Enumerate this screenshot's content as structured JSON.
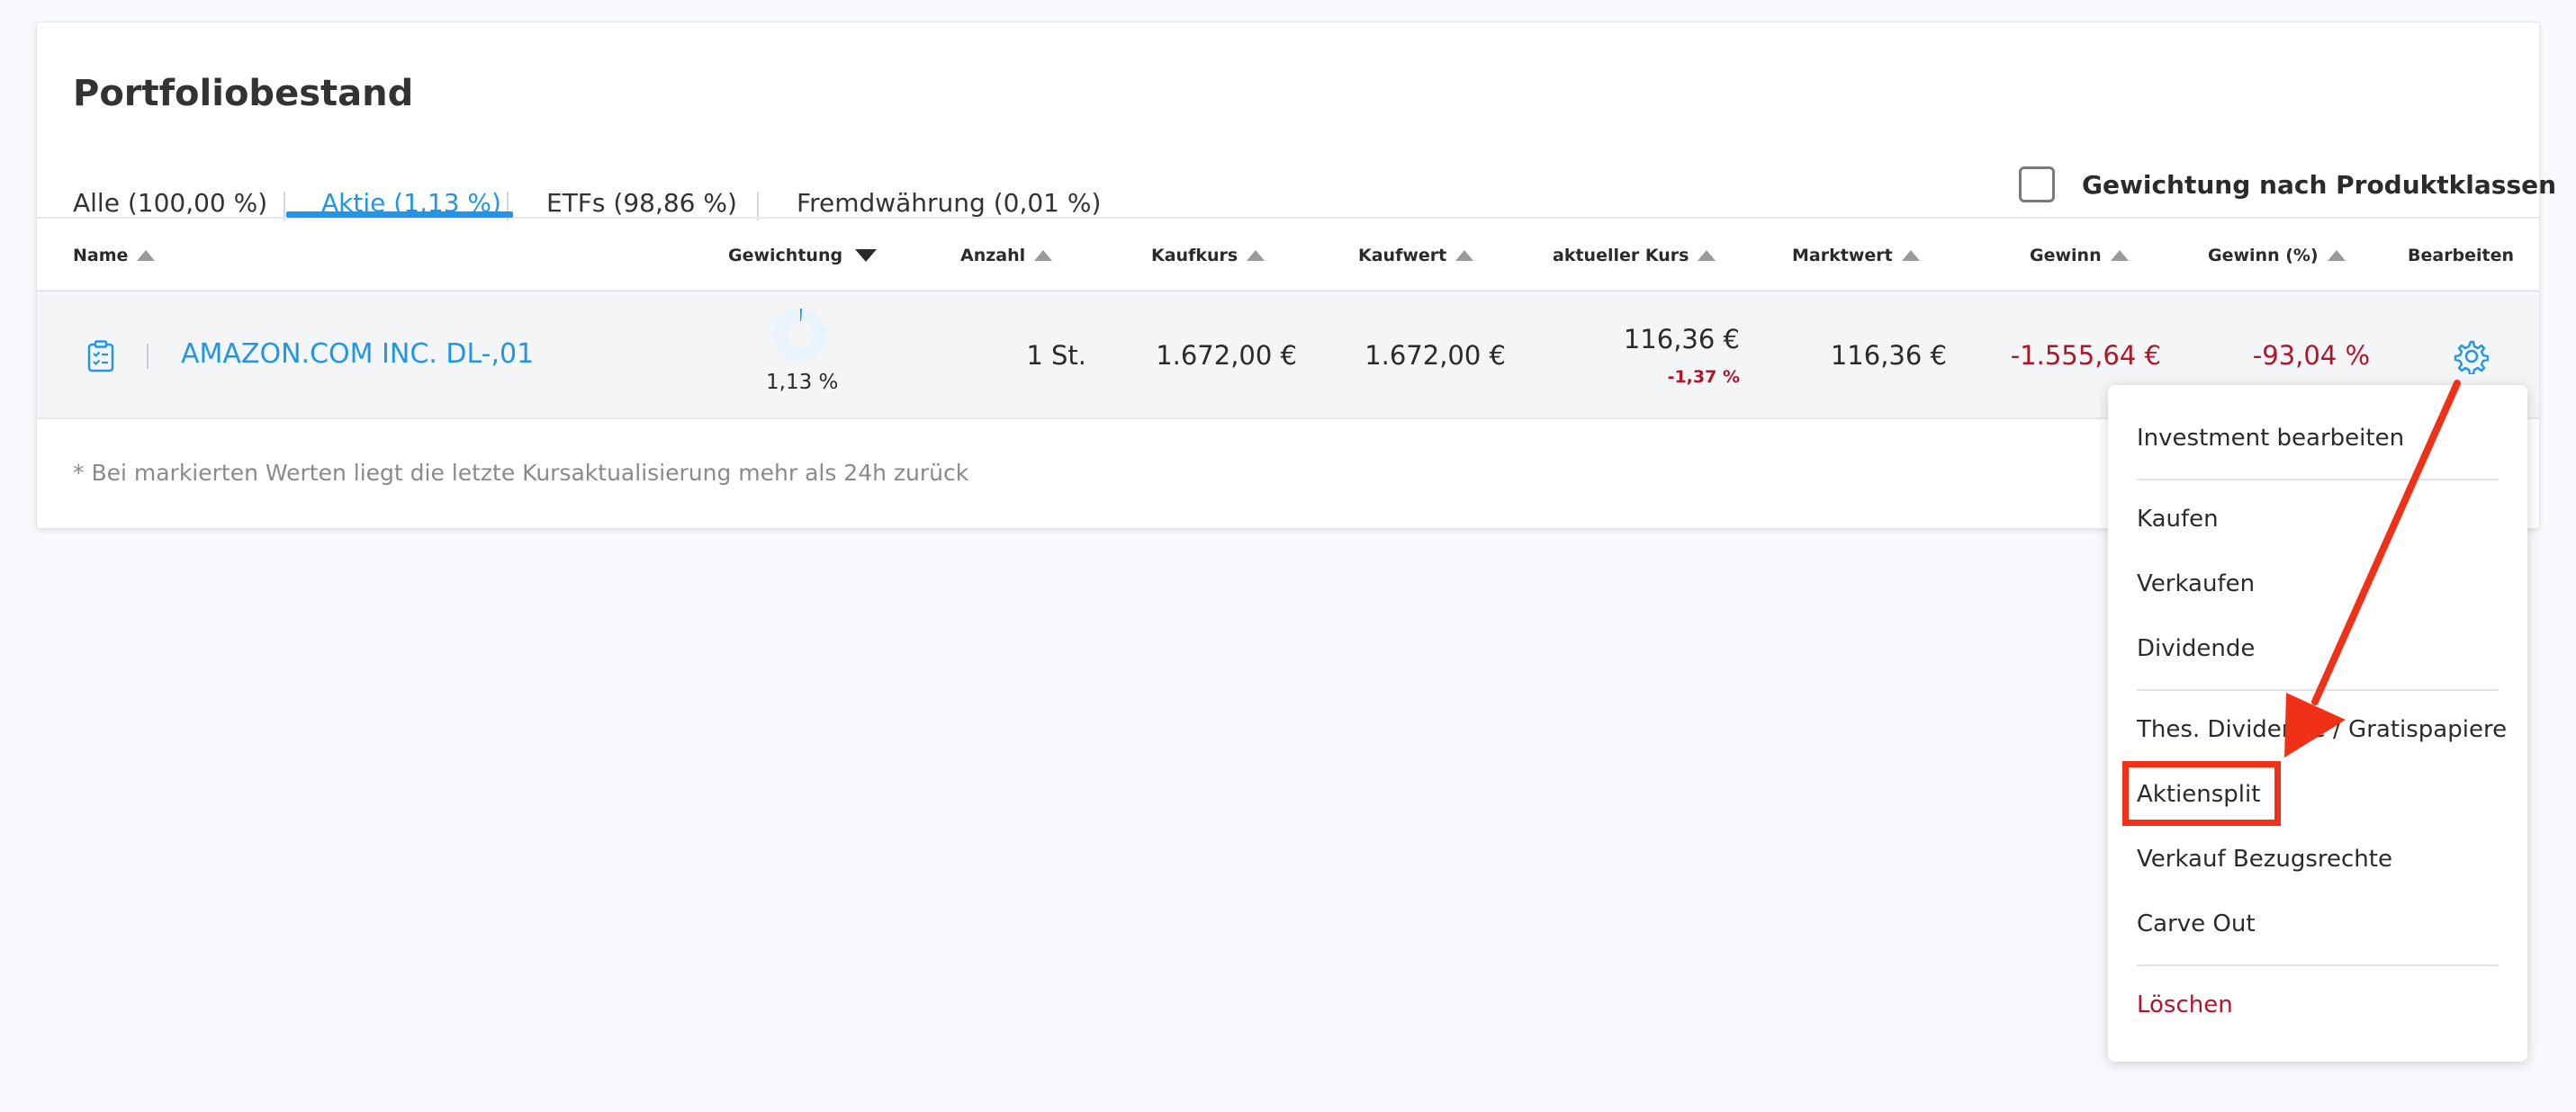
{
  "title": "Portfoliobestand",
  "tabs": [
    {
      "label": "Alle (100,00 %)",
      "active": false
    },
    {
      "label": "Aktie (1,13 %)",
      "active": true
    },
    {
      "label": "ETFs (98,86 %)",
      "active": false
    },
    {
      "label": "Fremdwährung (0,01 %)",
      "active": false
    }
  ],
  "weighting_toggle": {
    "label": "Gewichtung nach Produktklassen",
    "checked": false
  },
  "columns": {
    "name": "Name",
    "gewichtung": "Gewichtung",
    "anzahl": "Anzahl",
    "kaufkurs": "Kaufkurs",
    "kaufwert": "Kaufwert",
    "aktueller_kurs": "aktueller Kurs",
    "marktwert": "Marktwert",
    "gewinn": "Gewinn",
    "gewinn_pct": "Gewinn (%)",
    "bearbeiten": "Bearbeiten"
  },
  "rows": [
    {
      "name": "AMAZON.COM INC. DL-,01",
      "gewichtung": "1,13 %",
      "gewichtung_fraction": 0.0113,
      "anzahl": "1 St.",
      "kaufkurs": "1.672,00 €",
      "kaufwert": "1.672,00 €",
      "aktueller_kurs": "116,36 €",
      "kurs_change": "-1,37 %",
      "marktwert": "116,36 €",
      "gewinn": "-1.555,64 €",
      "gewinn_pct": "-93,04 %"
    }
  ],
  "footnote": "* Bei markierten Werten liegt die letzte Kursaktualisierung mehr als 24h zurück",
  "menu": {
    "items": [
      "Investment bearbeiten",
      "Kaufen",
      "Verkaufen",
      "Dividende",
      "Thes. Dividende / Gratispapiere",
      "Aktiensplit",
      "Verkauf Bezugsrechte",
      "Carve Out",
      "Löschen"
    ]
  },
  "colors": {
    "accent": "#2196e8",
    "negative": "#b31429",
    "annotation": "#f03017"
  }
}
